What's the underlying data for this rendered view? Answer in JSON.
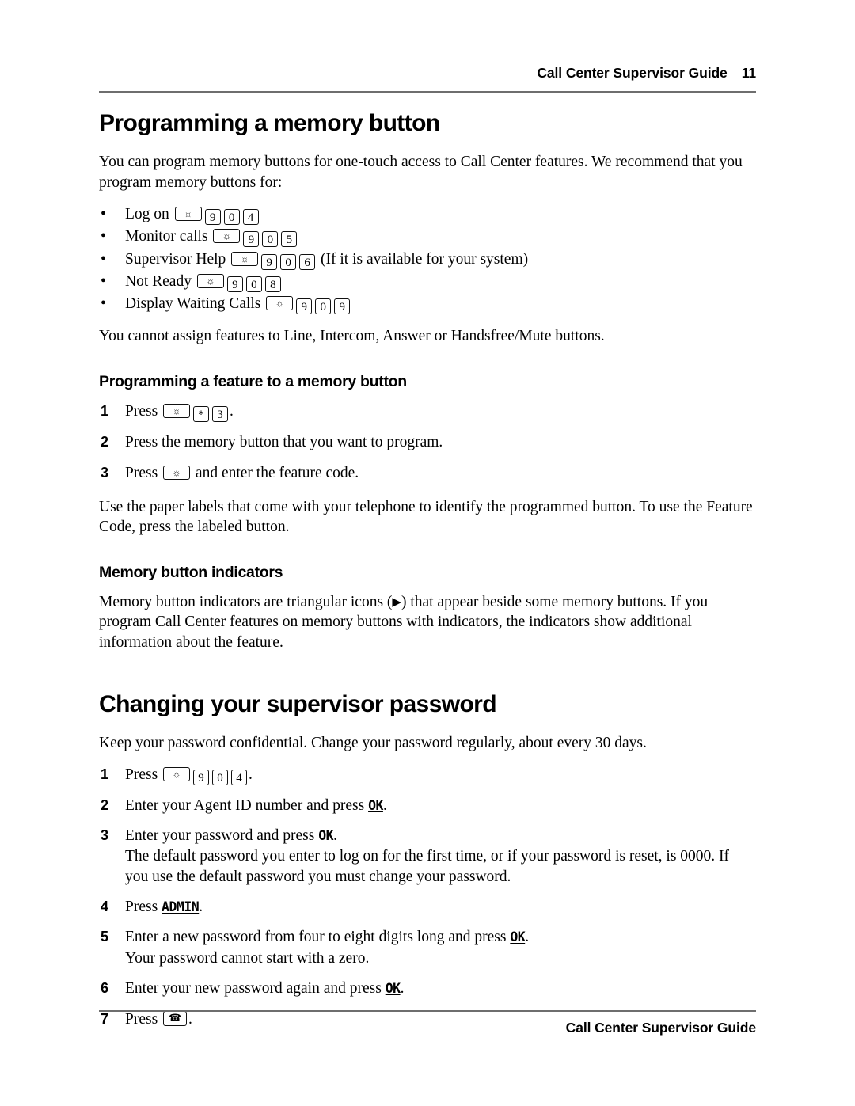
{
  "header": {
    "guide_title": "Call Center Supervisor Guide",
    "page_number": "11"
  },
  "footer": {
    "guide_title": "Call Center Supervisor Guide"
  },
  "sections": [
    {
      "id": "programming-a-memory-button",
      "heading": "Programming a memory button",
      "intro": "You can program memory buttons for one-touch access to Call Center features. We recommend that you program memory buttons for:",
      "bullets": [
        {
          "label": "Log on",
          "keys": [
            "feature",
            "9",
            "0",
            "4"
          ],
          "trailing": ""
        },
        {
          "label": "Monitor calls",
          "keys": [
            "feature",
            "9",
            "0",
            "5"
          ],
          "trailing": ""
        },
        {
          "label": "Supervisor Help",
          "keys": [
            "feature",
            "9",
            "0",
            "6"
          ],
          "trailing": "(If it is available for your system)"
        },
        {
          "label": "Not Ready",
          "keys": [
            "feature",
            "9",
            "0",
            "8"
          ],
          "trailing": ""
        },
        {
          "label": "Display Waiting Calls",
          "keys": [
            "feature",
            "9",
            "0",
            "9"
          ],
          "trailing": ""
        }
      ],
      "after_bullets": "You cannot assign features to Line, Intercom, Answer or Handsfree/Mute buttons."
    },
    {
      "id": "programming-a-feature-to-a-memory-button",
      "subheading": "Programming a feature to a memory button",
      "steps": [
        {
          "num": "1",
          "pre": "Press",
          "keys": [
            "feature",
            "*",
            "3"
          ],
          "post": "."
        },
        {
          "num": "2",
          "pre": "Press the memory button that you want to program.",
          "keys": [],
          "post": ""
        },
        {
          "num": "3",
          "pre": "Press",
          "keys": [
            "feature"
          ],
          "post": "and enter the feature code."
        }
      ],
      "after_steps": "Use the paper labels that come with your telephone to identify the programmed button. To use the Feature Code, press the labeled button."
    },
    {
      "id": "memory-button-indicators",
      "subheading": "Memory button indicators",
      "body_before_icon": "Memory button indicators are triangular icons (",
      "icon_glyph": "▶",
      "body_after_icon": ") that appear beside some memory buttons. If you program Call Center features on memory buttons with indicators, the indicators show additional information about the feature."
    },
    {
      "id": "changing-your-supervisor-password",
      "heading": "Changing your supervisor password",
      "intro": "Keep your password confidential. Change your password regularly, about every 30 days.",
      "steps": [
        {
          "num": "1",
          "pre": "Press",
          "keys": [
            "feature",
            "9",
            "0",
            "4"
          ],
          "post": ".",
          "sub": ""
        },
        {
          "num": "2",
          "pre": "Enter your Agent ID number and press",
          "keys": [],
          "softkey": "OK",
          "post": ".",
          "sub": ""
        },
        {
          "num": "3",
          "pre": "Enter your password and press",
          "keys": [],
          "softkey": "OK",
          "post": ".",
          "sub": "The default password you enter to log on for the first time, or if your password is reset, is 0000. If you use the default password you must change your password."
        },
        {
          "num": "4",
          "pre": "Press",
          "keys": [],
          "softkey": "ADMIN",
          "post": ".",
          "sub": ""
        },
        {
          "num": "5",
          "pre": "Enter a new password from four to eight digits long and press",
          "keys": [],
          "softkey": "OK",
          "post": ".",
          "sub": "Your password cannot start with a zero."
        },
        {
          "num": "6",
          "pre": "Enter your new password again and press",
          "keys": [],
          "softkey": "OK",
          "post": ".",
          "sub": ""
        },
        {
          "num": "7",
          "pre": "Press",
          "keys": [
            "release"
          ],
          "post": ".",
          "sub": ""
        }
      ]
    }
  ],
  "glyphs": {
    "feature_key": "☼",
    "release_key": "☎",
    "bullet": "•"
  },
  "colors": {
    "text": "#000000",
    "rule": "#6e6e6e",
    "page_background": "#ffffff"
  }
}
